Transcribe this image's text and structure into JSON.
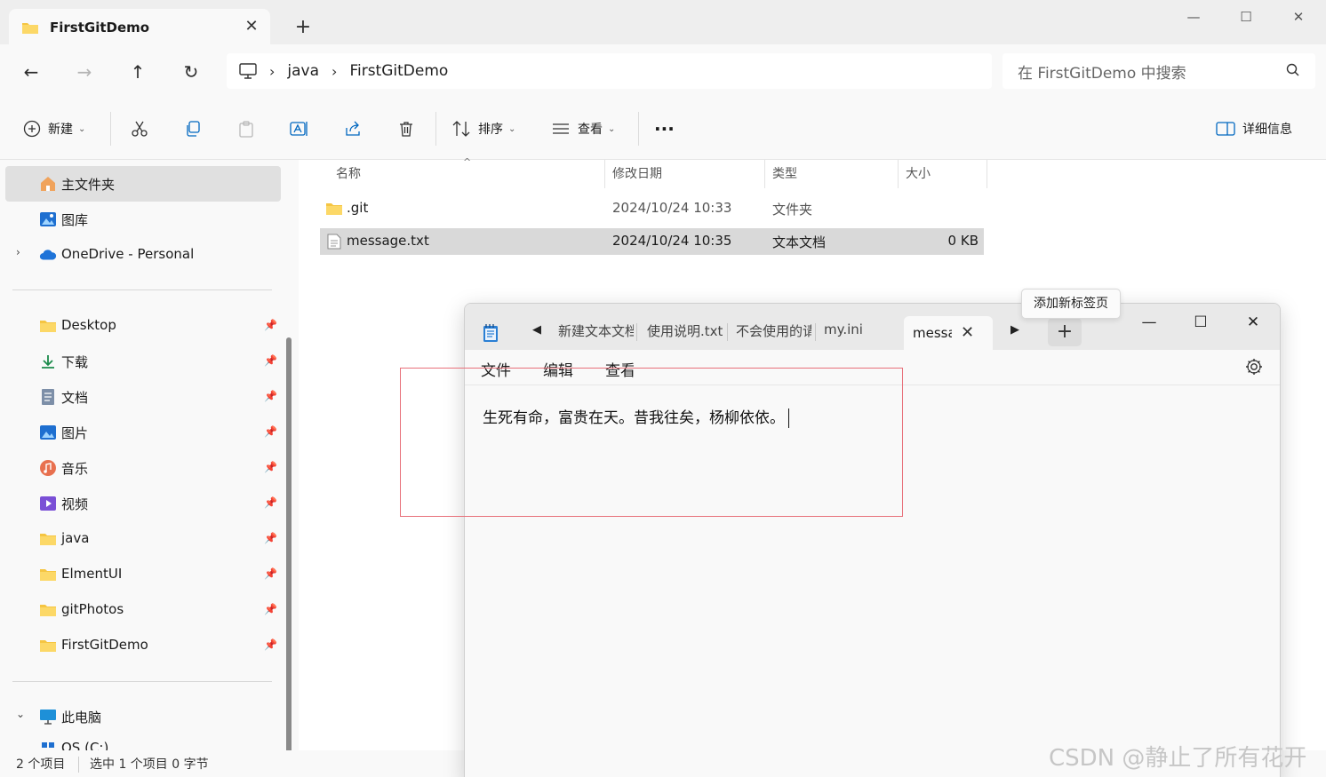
{
  "explorer": {
    "tab_title": "FirstGitDemo",
    "tab_close": "✕",
    "new_tab": "+",
    "window_controls": {
      "minimize": "—",
      "maximize": "☐",
      "close": "✕"
    },
    "nav": {
      "back": "←",
      "forward": "→",
      "up": "↑",
      "refresh": "↻"
    },
    "breadcrumb": [
      "java",
      "FirstGitDemo"
    ],
    "breadcrumb_sep": "›",
    "search_placeholder": "在 FirstGitDemo 中搜索",
    "commands": {
      "new": "新建",
      "sort": "排序",
      "view": "查看",
      "more": "···",
      "details": "详细信息",
      "caret": "⌄"
    },
    "sidebar": {
      "top": [
        {
          "label": "主文件夹",
          "icon": "home-icon"
        },
        {
          "label": "图库",
          "icon": "gallery-icon"
        },
        {
          "label": "OneDrive - Personal",
          "icon": "cloud-icon",
          "chevron": "›"
        }
      ],
      "quick": [
        {
          "label": "Desktop",
          "icon": "folder-icon"
        },
        {
          "label": "下载",
          "icon": "download-icon"
        },
        {
          "label": "文档",
          "icon": "document-icon"
        },
        {
          "label": "图片",
          "icon": "pictures-icon"
        },
        {
          "label": "音乐",
          "icon": "music-icon"
        },
        {
          "label": "视频",
          "icon": "video-icon"
        },
        {
          "label": "java",
          "icon": "folder-icon"
        },
        {
          "label": "ElmentUI",
          "icon": "folder-icon"
        },
        {
          "label": "gitPhotos",
          "icon": "folder-icon"
        },
        {
          "label": "FirstGitDemo",
          "icon": "folder-icon"
        }
      ],
      "this_pc": {
        "label": "此电脑",
        "chevron": "⌄"
      },
      "drive_partial": "OS (C:)",
      "pin": "📌"
    },
    "columns": {
      "name": "名称",
      "modified": "修改日期",
      "type": "类型",
      "size": "大小",
      "sort_indicator": "^"
    },
    "files": [
      {
        "name": ".git",
        "modified": "2024/10/24 10:33",
        "type": "文件夹",
        "size": "",
        "icon": "folder-icon"
      },
      {
        "name": "message.txt",
        "modified": "2024/10/24 10:35",
        "type": "文本文档",
        "size": "0 KB",
        "icon": "text-file-icon"
      }
    ],
    "status": {
      "count": "2 个项目",
      "selection": "选中 1 个项目  0 字节"
    }
  },
  "notepad": {
    "tabs": [
      "新建文本文档",
      "使用说明.txt",
      "不会使用的请",
      "my.ini"
    ],
    "active_tab": "message.txt",
    "tab_close": "✕",
    "prev": "◀",
    "next": "▶",
    "add_tab": "+",
    "tooltip": "添加新标签页",
    "window_controls": {
      "minimize": "—",
      "maximize": "☐",
      "close": "✕"
    },
    "menu": {
      "file": "文件",
      "edit": "编辑",
      "view": "查看"
    },
    "content": "生死有命，富贵在天。昔我往矣，杨柳依依。"
  },
  "watermark": "CSDN @静止了所有花开",
  "colors": {
    "selection": "#d9d9d9",
    "annotation": "#e8707a",
    "folder": "#f5c542",
    "accent": "#0067c0"
  }
}
